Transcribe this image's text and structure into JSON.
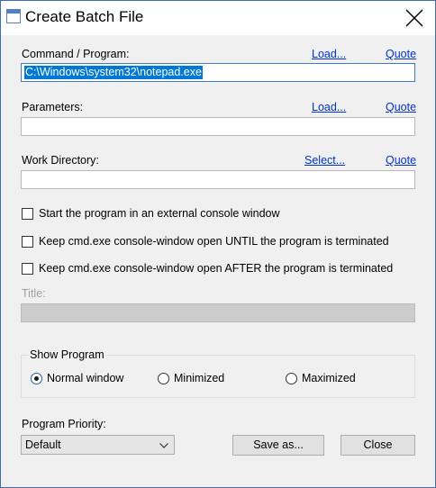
{
  "window": {
    "title": "Create Batch File"
  },
  "command": {
    "label": "Command / Program:",
    "load_link": "Load...",
    "quote_link": "Quote",
    "value": "C:\\Windows\\system32\\notepad.exe"
  },
  "parameters": {
    "label": "Parameters:",
    "load_link": "Load...",
    "quote_link": "Quote",
    "value": ""
  },
  "workdir": {
    "label": "Work Directory:",
    "select_link": "Select...",
    "quote_link": "Quote",
    "value": ""
  },
  "options": [
    {
      "label": "Start the program in an external console window",
      "checked": false
    },
    {
      "label": "Keep cmd.exe console-window open UNTIL the program is terminated",
      "checked": false
    },
    {
      "label": "Keep cmd.exe console-window open AFTER the program is terminated",
      "checked": false
    }
  ],
  "title_field": {
    "label": "Title:",
    "value": "",
    "enabled": false
  },
  "show_program": {
    "legend": "Show Program",
    "options": [
      {
        "label": "Normal window",
        "selected": true
      },
      {
        "label": "Minimized",
        "selected": false
      },
      {
        "label": "Maximized",
        "selected": false
      }
    ]
  },
  "priority": {
    "label": "Program Priority:",
    "value": "Default"
  },
  "buttons": {
    "save_as": "Save as...",
    "close": "Close"
  }
}
